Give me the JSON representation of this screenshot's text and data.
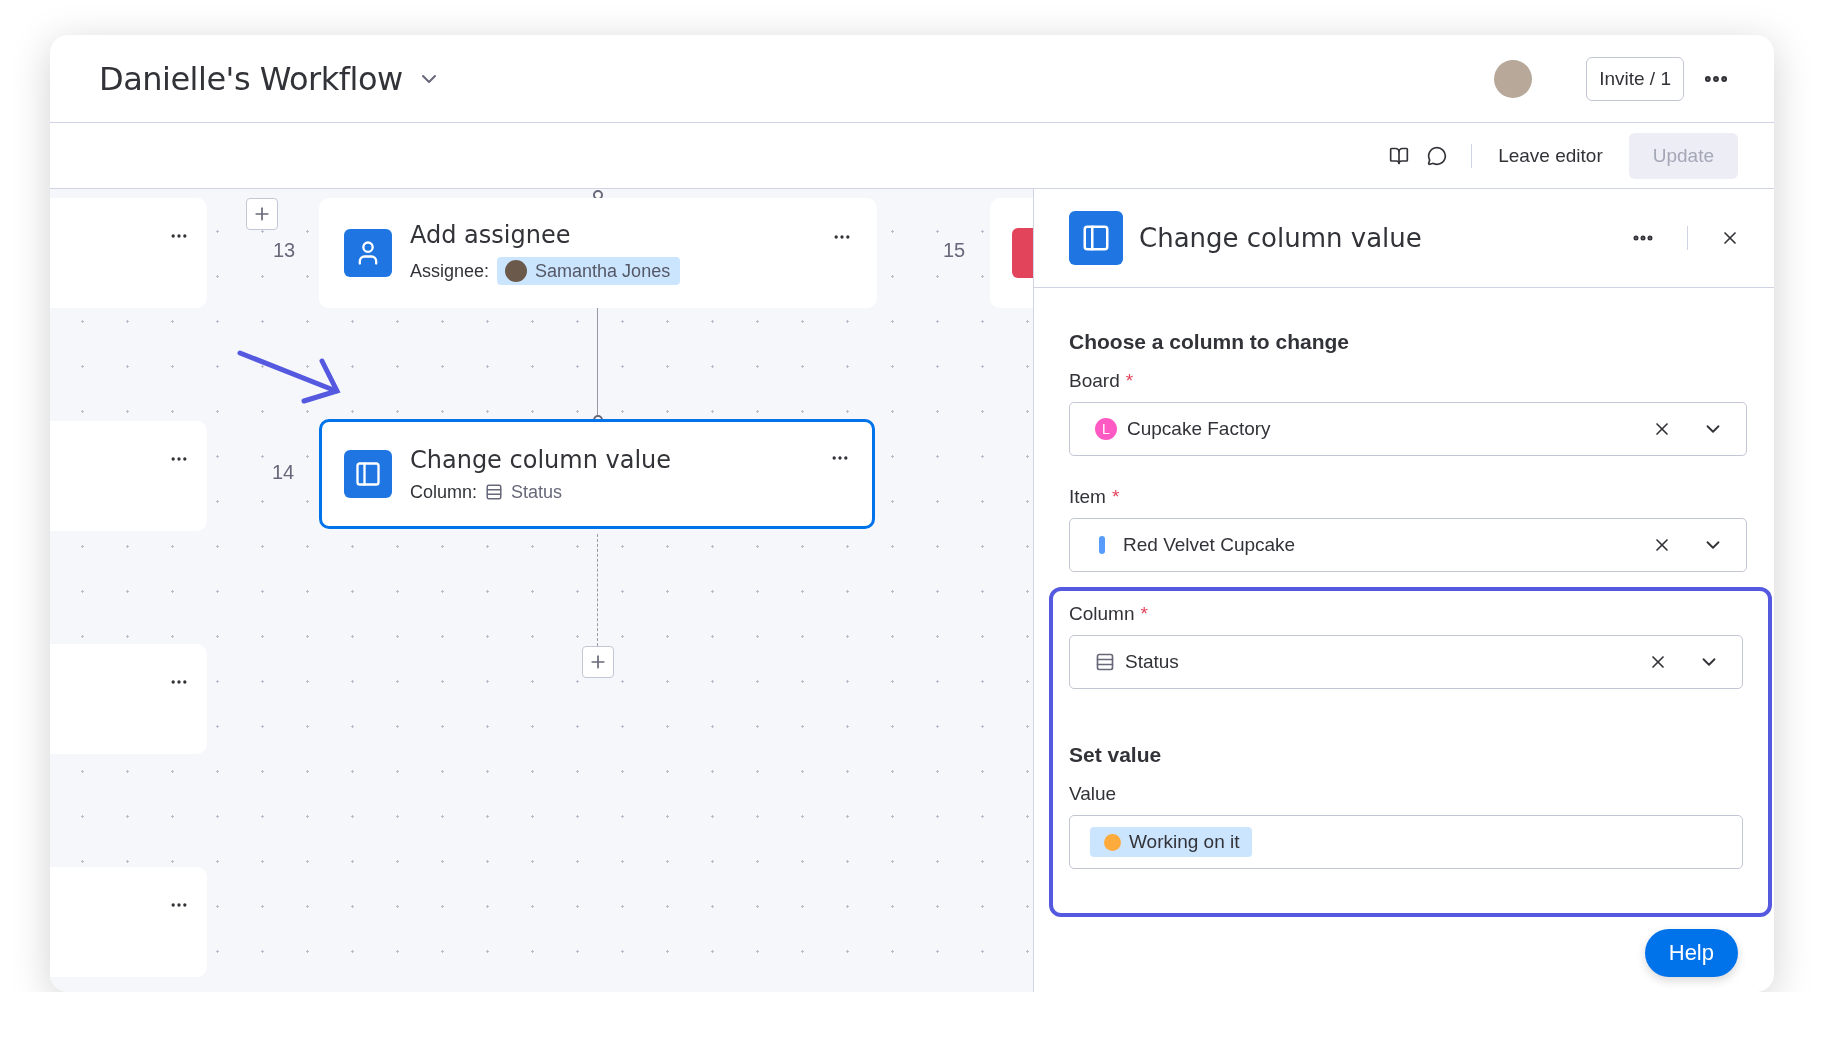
{
  "header": {
    "title": "Danielle's Workflow",
    "invite_button": "Invite / 1"
  },
  "toolbar": {
    "leave_editor": "Leave editor",
    "update_button": {
      "label": "Update",
      "disabled": true
    }
  },
  "canvas": {
    "step_numbers": [
      "13",
      "14",
      "15"
    ],
    "nodes": [
      {
        "kind": "assignee",
        "title": "Add assignee",
        "field_label": "Assignee:",
        "value": "Samantha Jones",
        "selected": false
      },
      {
        "kind": "column",
        "title": "Change column value",
        "field_label": "Column:",
        "value": "Status",
        "selected": true
      }
    ]
  },
  "panel": {
    "title": "Change column value",
    "section_title": "Choose a column to change",
    "required_mark": "*",
    "fields": [
      {
        "kind": "board",
        "label": "Board",
        "required": true,
        "value": "Cupcake Factory",
        "badge": "L"
      },
      {
        "kind": "item",
        "label": "Item",
        "required": true,
        "value": "Red Velvet Cupcake"
      }
    ],
    "highlighted": {
      "fields": [
        {
          "kind": "column",
          "label": "Column",
          "required": true,
          "value": "Status"
        }
      ],
      "section_title": "Set value",
      "value_field": {
        "label": "Value",
        "chip": "Working on it"
      }
    }
  },
  "help_button": "Help"
}
